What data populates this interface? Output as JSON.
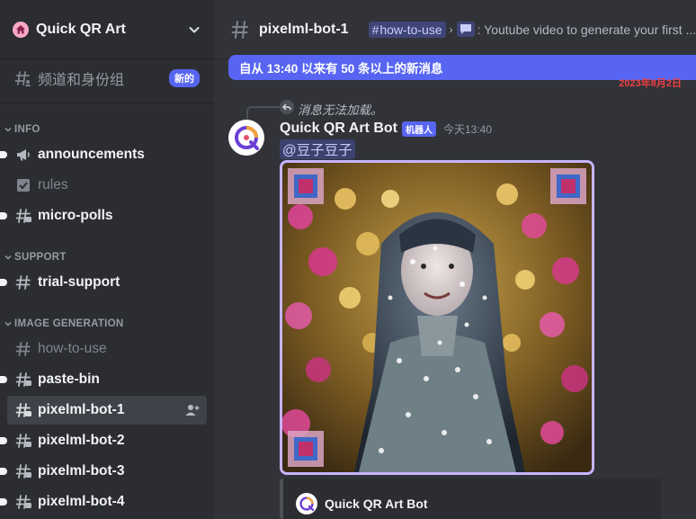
{
  "server": {
    "name": "Quick QR Art",
    "icon": "home-icon"
  },
  "roles_row": {
    "label": "频道和身份组",
    "badge": "新的"
  },
  "categories": [
    {
      "label": "INFO"
    },
    {
      "label": "SUPPORT"
    },
    {
      "label": "IMAGE GENERATION"
    }
  ],
  "channels": {
    "announcements": {
      "label": "announcements",
      "icon": "megaphone-icon"
    },
    "rules": {
      "label": "rules",
      "icon": "checkbox-icon"
    },
    "micro_polls": {
      "label": "micro-polls",
      "icon": "hash-threads-icon"
    },
    "trial_support": {
      "label": "trial-support",
      "icon": "hash-icon"
    },
    "how_to_use": {
      "label": "how-to-use",
      "icon": "hash-icon"
    },
    "paste_bin": {
      "label": "paste-bin",
      "icon": "hash-threads-icon"
    },
    "pixelml_bot_1": {
      "label": "pixelml-bot-1",
      "icon": "hash-threads-icon"
    },
    "pixelml_bot_2": {
      "label": "pixelml-bot-2",
      "icon": "hash-threads-icon"
    },
    "pixelml_bot_3": {
      "label": "pixelml-bot-3",
      "icon": "hash-threads-icon"
    },
    "pixelml_bot_4": {
      "label": "pixelml-bot-4",
      "icon": "hash-threads-icon"
    }
  },
  "topbar": {
    "channel_name": "pixelml-bot-1",
    "topic_channel": "how-to-use",
    "topic_text": ": Youtube video to generate your first ..."
  },
  "new_messages_bar": "自从 13:40 以来有 50 条以上的新消息",
  "date_divider": "2023年8月2日",
  "message": {
    "reply_text": "消息无法加载。",
    "author": "Quick QR Art Bot",
    "bot_tag": "机器人",
    "timestamp": "今天13:40",
    "mention": "@豆子豆子"
  },
  "embed": {
    "author": "Quick QR Art Bot"
  },
  "colors": {
    "accent": "#5865f2",
    "sidebar": "#2b2d31",
    "main": "#313338",
    "new_line": "#f23f43"
  }
}
